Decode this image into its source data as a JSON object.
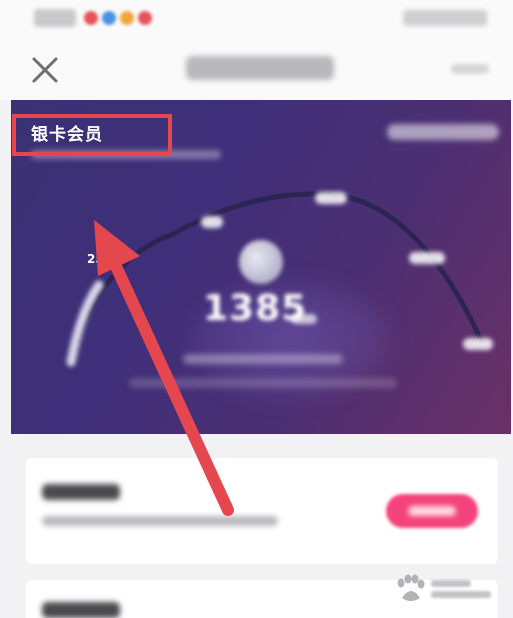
{
  "hero": {
    "level_name": "银卡会员",
    "gauge_start_label": "25"
  },
  "colors": {
    "banner": "#3f2f7a",
    "accent_button": "#f4437c",
    "annotation": "#e5474f"
  },
  "icons": {
    "close": "close-icon",
    "watermark": "baidu-paw-icon"
  }
}
